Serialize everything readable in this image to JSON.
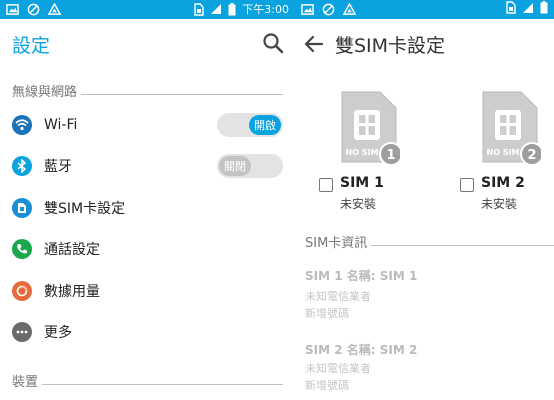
{
  "statusbar": {
    "time": "下午3:00"
  },
  "left": {
    "title": "設定",
    "sections": [
      {
        "label": "無線與網路"
      },
      {
        "label": "裝置"
      }
    ],
    "items": [
      {
        "label": "Wi-Fi",
        "icon": "wifi-icon",
        "toggle": "開啟",
        "color": "#1a73b8"
      },
      {
        "label": "藍牙",
        "icon": "bluetooth-icon",
        "toggle": "關閉",
        "color": "#0aa2df"
      },
      {
        "label": "雙SIM卡設定",
        "icon": "sim-icon",
        "color": "#1a8fd4"
      },
      {
        "label": "通話設定",
        "icon": "phone-icon",
        "color": "#1aa84f"
      },
      {
        "label": "數據用量",
        "icon": "data-usage-icon",
        "color": "#e66b3c"
      },
      {
        "label": "更多",
        "icon": "more-icon",
        "color": "#6b6b6b"
      }
    ]
  },
  "right": {
    "title": "雙SIM卡設定",
    "sims": [
      {
        "card_text": "NO SIM",
        "number": "1",
        "name": "SIM 1",
        "status": "未安裝"
      },
      {
        "card_text": "NO SIM",
        "number": "2",
        "name": "SIM 2",
        "status": "未安裝"
      }
    ],
    "section": "SIM卡資訊",
    "info": [
      {
        "title": "SIM 1 名稱: SIM 1",
        "carrier": "未知電信業者",
        "add_number": "新增號碼"
      },
      {
        "title": "SIM 2 名稱: SIM 2",
        "carrier": "未知電信業者",
        "add_number": "新增號碼"
      }
    ]
  },
  "colors": {
    "accent": "#0aa2df"
  }
}
